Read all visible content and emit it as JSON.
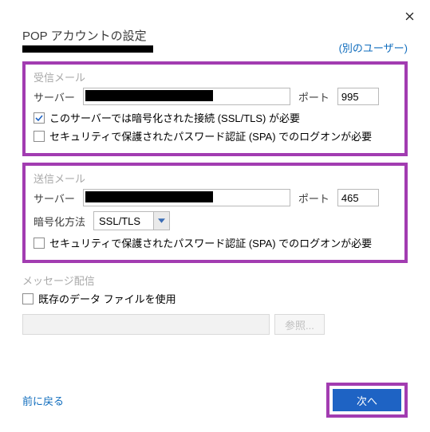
{
  "dialog": {
    "title": "POP アカウントの設定",
    "other_user_link": "(別のユーザー)"
  },
  "incoming": {
    "section_title": "受信メール",
    "server_label": "サーバー",
    "server_value": "",
    "port_label": "ポート",
    "port_value": "995",
    "ssl_checkbox_label": "このサーバーでは暗号化された接続 (SSL/TLS) が必要",
    "spa_checkbox_label": "セキュリティで保護されたパスワード認証 (SPA) でのログオンが必要"
  },
  "outgoing": {
    "section_title": "送信メール",
    "server_label": "サーバー",
    "server_value": "",
    "port_label": "ポート",
    "port_value": "465",
    "enc_label": "暗号化方法",
    "enc_value": "SSL/TLS",
    "spa_checkbox_label": "セキュリティで保護されたパスワード認証 (SPA) でのログオンが必要"
  },
  "delivery": {
    "section_title": "メッセージ配信",
    "datafile_checkbox_label": "既存のデータ ファイルを使用",
    "browse_label": "参照..."
  },
  "footer": {
    "back_label": "前に戻る",
    "next_label": "次へ"
  }
}
